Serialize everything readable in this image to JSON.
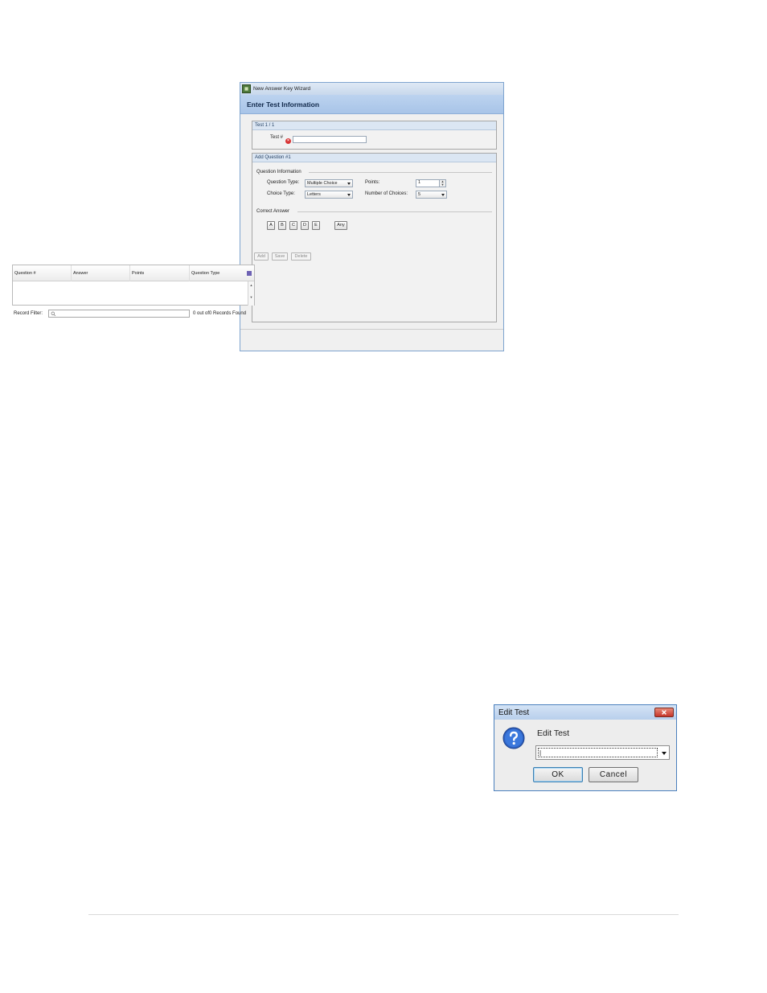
{
  "wizard": {
    "window_title": "New Answer Key Wizard",
    "header": "Enter Test Information",
    "test_group": {
      "heading": "Test 1 / 1",
      "test_label": "Test #",
      "test_value": ""
    },
    "question_group": {
      "heading": "Add Question #1",
      "info_section": "Question Information",
      "question_type_label": "Question Type:",
      "question_type_value": "Multiple Choice",
      "choice_type_label": "Choice Type:",
      "choice_type_value": "Letters",
      "points_label": "Points:",
      "points_value": "1",
      "num_choices_label": "Number of Choices:",
      "num_choices_value": "5",
      "correct_section": "Correct Answer",
      "answers": [
        "A",
        "B",
        "C",
        "D",
        "E"
      ],
      "any_label": "Any",
      "add_label": "Add",
      "save_label": "Save",
      "delete_label": "Delete"
    },
    "table": {
      "columns": [
        "Question #",
        "Answer",
        "Points",
        "Question Type"
      ],
      "rows": []
    },
    "filter": {
      "label": "Record Filter:",
      "placeholder": "",
      "status": "0 out of0 Records Found"
    }
  },
  "edit_dialog": {
    "title": "Edit Test",
    "message": "Edit Test",
    "value": "|",
    "ok_label": "OK",
    "cancel_label": "Cancel"
  }
}
